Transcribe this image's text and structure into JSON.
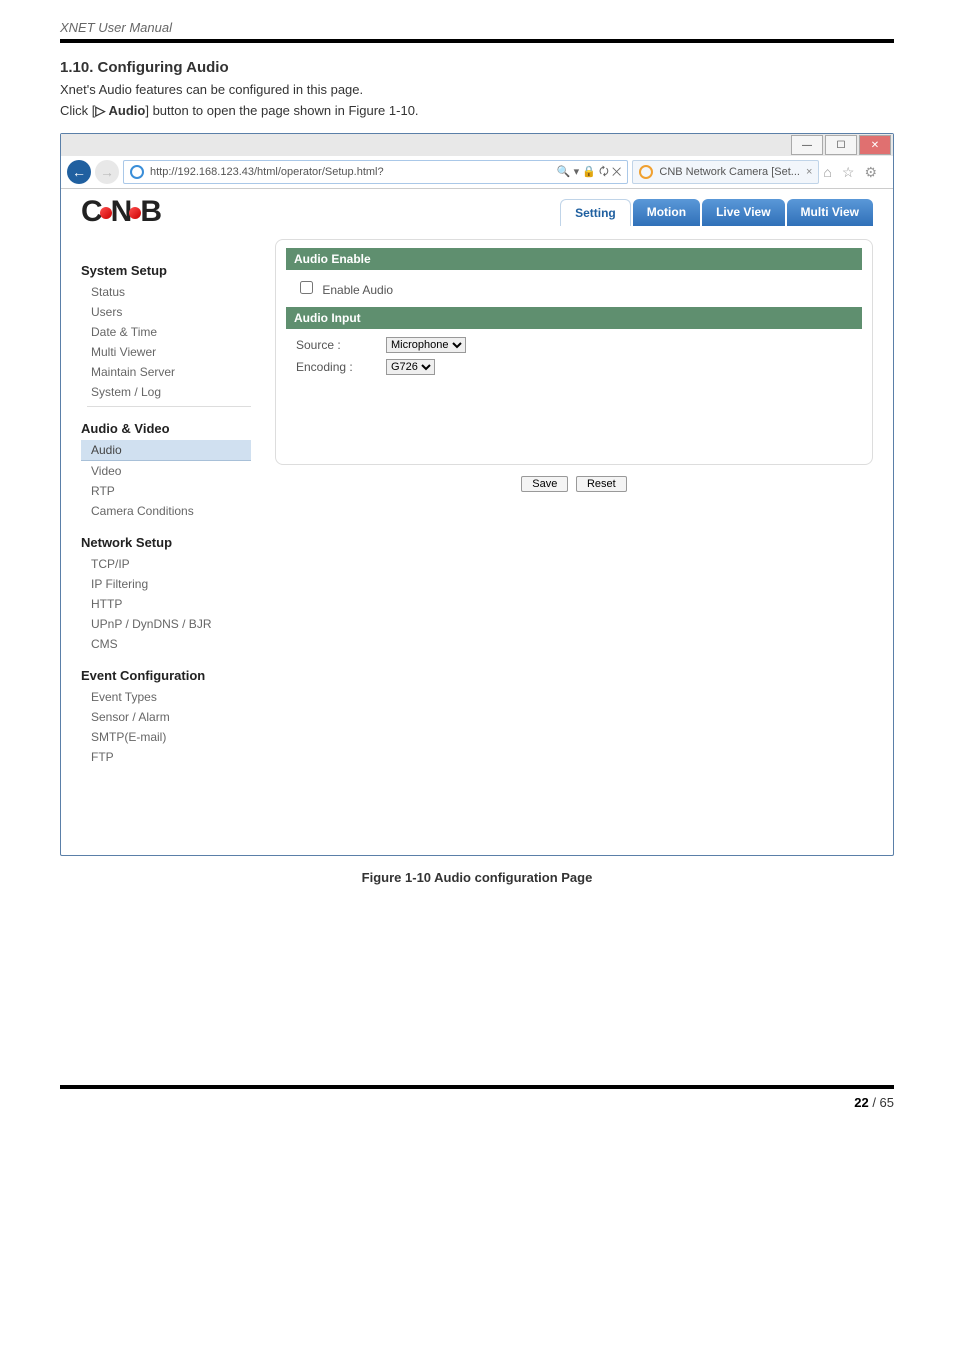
{
  "doc": {
    "header": "XNET User Manual",
    "section_title": "1.10. Configuring Audio",
    "section_line1": "Xnet's Audio features can be configured in this page.",
    "section_line2_pre": "Click [",
    "section_line2_btn": "▷ Audio",
    "section_line2_post": "] button to open the page shown in Figure 1-10.",
    "figure_caption": "Figure 1-10 Audio configuration Page",
    "page_num": "22",
    "page_total": "/ 65"
  },
  "browser": {
    "url": "http://192.168.123.43/html/operator/Setup.html?",
    "addr_symbols": "🔍 ▾ 🔒 🗘 ✕",
    "tab_title": "CNB Network Camera [Set...",
    "tab_close": "×",
    "icons": {
      "home": "⌂",
      "star": "☆",
      "gear": "⚙"
    }
  },
  "logo": {
    "part1": "C",
    "part2": "N",
    "part3": "B"
  },
  "nav": {
    "setting": "Setting",
    "motion": "Motion",
    "liveview": "Live View",
    "multiview": "Multi View"
  },
  "sidebar": {
    "system": {
      "title": "System Setup",
      "status": "Status",
      "users": "Users",
      "datetime": "Date & Time",
      "multiviewer": "Multi Viewer",
      "maintain": "Maintain Server",
      "syslog": "System / Log"
    },
    "av": {
      "title": "Audio & Video",
      "audio": "Audio",
      "video": "Video",
      "rtp": "RTP",
      "camcond": "Camera Conditions"
    },
    "network": {
      "title": "Network Setup",
      "tcpip": "TCP/IP",
      "ipfilter": "IP Filtering",
      "http": "HTTP",
      "upnp": "UPnP / DynDNS / BJR",
      "cms": "CMS"
    },
    "event": {
      "title": "Event Configuration",
      "types": "Event Types",
      "sensor": "Sensor / Alarm",
      "smtp": "SMTP(E-mail)",
      "ftp": "FTP"
    }
  },
  "panel": {
    "enable_hdr": "Audio Enable",
    "enable_label": "Enable Audio",
    "input_hdr": "Audio Input",
    "source_label": "Source :",
    "source_value": "Microphone",
    "encoding_label": "Encoding :",
    "encoding_value": "G726",
    "save": "Save",
    "reset": "Reset"
  }
}
